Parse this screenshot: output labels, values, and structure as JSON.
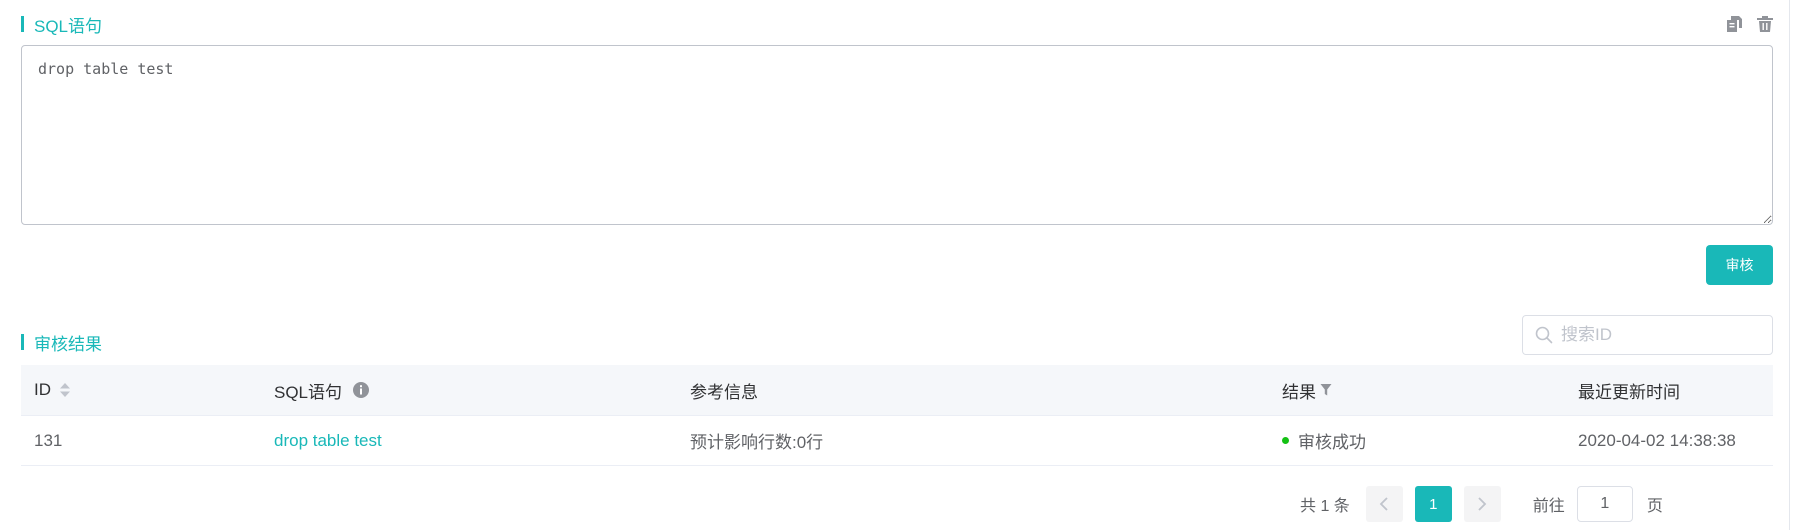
{
  "sql_section": {
    "title": "SQL语句",
    "editor_value": "drop table test",
    "copy_icon": "copy-icon",
    "delete_icon": "trash-icon"
  },
  "audit_button": {
    "label": "审核"
  },
  "results_section": {
    "title": "审核结果",
    "search": {
      "placeholder": "搜索ID",
      "value": ""
    },
    "columns": [
      {
        "label": "ID",
        "sortable": true
      },
      {
        "label": "SQL语句",
        "info_icon": "info-icon"
      },
      {
        "label": "参考信息"
      },
      {
        "label": "结果",
        "filter_icon": "filter-icon"
      },
      {
        "label": "最近更新时间"
      }
    ],
    "rows": [
      {
        "id": "131",
        "sql": "drop table test",
        "info": "预计影响行数:0行",
        "result": "审核成功",
        "updated": "2020-04-02 14:38:38"
      }
    ]
  },
  "pagination": {
    "total_text": "共 1 条",
    "current_page": "1",
    "goto_label": "前往",
    "goto_value": "1",
    "page_unit": "页"
  },
  "colors": {
    "accent": "#19b8b8",
    "success": "#14c114",
    "header_bg": "#f5f7fa"
  }
}
